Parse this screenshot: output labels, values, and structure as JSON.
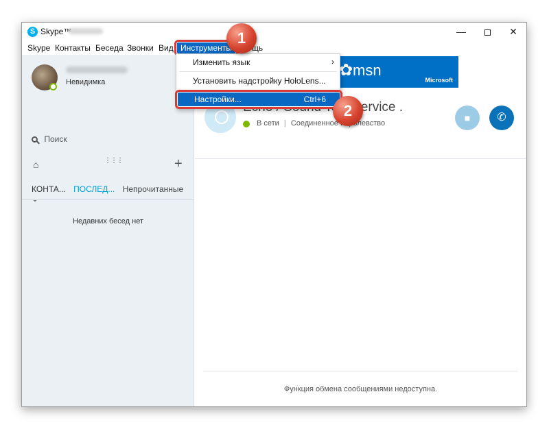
{
  "window": {
    "app_title": "Skype™",
    "min_glyph": "—",
    "close_glyph": "✕"
  },
  "menu": {
    "items": [
      "Skype",
      "Контакты",
      "Беседа",
      "Звонки",
      "Вид",
      "Инструменты",
      "щь"
    ]
  },
  "dropdown": {
    "items": [
      {
        "label": "Изменить язык",
        "arrow": "›"
      },
      {
        "label": "Установить надстройку HoloLens..."
      },
      {
        "label": "Настройки...",
        "shortcut": "Ctrl+6"
      }
    ]
  },
  "sidebar": {
    "profile_status": "Невидимка",
    "search_placeholder": "Поиск",
    "tabs": [
      "КОНТА...",
      "ПОСЛЕД...",
      "Непрочитанные ⌄"
    ],
    "empty_text": "Недавних бесед нет"
  },
  "main": {
    "banner_logo": "msn",
    "banner_brand": "Microsoft",
    "contact_name": "Echo / Sound Test Service .",
    "contact_online": "В сети",
    "contact_extra": "Соединенное Королевство",
    "footer_text": "Функция обмена сообщениями недоступна."
  },
  "badges": [
    "1",
    "2"
  ],
  "colors": {
    "accent": "#0a67c2",
    "highlight_border": "#d83b34",
    "online": "#7fba00",
    "skype_blue": "#00aff0"
  }
}
